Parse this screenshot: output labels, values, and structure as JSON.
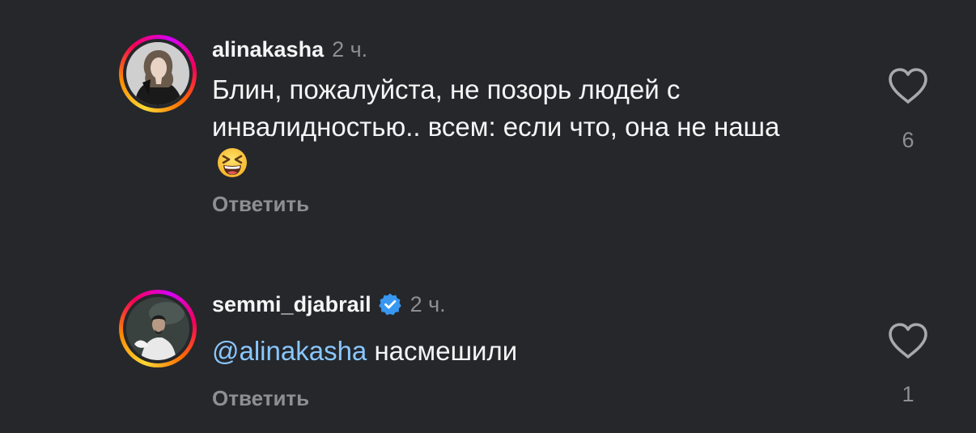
{
  "comments": [
    {
      "username": "alinakasha",
      "time": "2 ч.",
      "text": "Блин, пожалуйста, не позорь людей с инвалидностью.. всем: если что, она не наша",
      "emoji": "grinning-squinting-face",
      "reply_label": "Ответить",
      "like_count": "6",
      "verified": false
    },
    {
      "username": "semmi_djabrail",
      "time": "2 ч.",
      "mention": "@alinakasha",
      "text": "насмешили",
      "reply_label": "Ответить",
      "like_count": "1",
      "verified": true
    }
  ],
  "colors": {
    "background": "#25272b",
    "text": "#f5f5f5",
    "muted": "#8e8e93",
    "mention": "#8ac7ff",
    "verified": "#3897f0"
  }
}
